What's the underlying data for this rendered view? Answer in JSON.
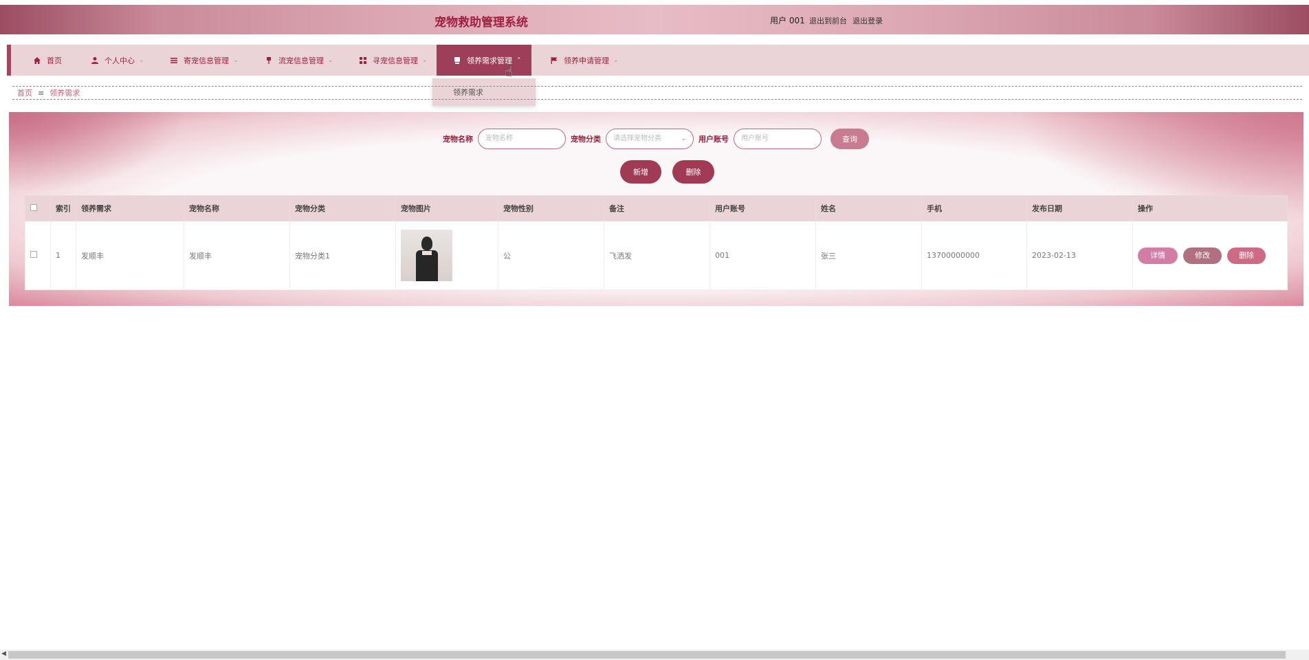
{
  "header": {
    "title": "宠物救助管理系统",
    "user": "用户 001",
    "to_front": "退出到前台",
    "logout": "退出登录"
  },
  "nav": [
    {
      "label": "首页",
      "icon": "home-icon"
    },
    {
      "label": "个人中心",
      "icon": "user-icon"
    },
    {
      "label": "寄宠信息管理",
      "icon": "list-icon"
    },
    {
      "label": "流宠信息管理",
      "icon": "pin-icon"
    },
    {
      "label": "寻宠信息管理",
      "icon": "grid-icon"
    },
    {
      "label": "领养需求管理",
      "icon": "doc-icon"
    },
    {
      "label": "领养申请管理",
      "icon": "flag-icon"
    }
  ],
  "dropdown": {
    "item": "领养需求"
  },
  "breadcrumb": {
    "home": "首页",
    "current": "领养需求"
  },
  "search": {
    "name_label": "宠物名称",
    "name_placeholder": "宠物名称",
    "category_label": "宠物分类",
    "category_placeholder": "请选择宠物分类",
    "account_label": "用户账号",
    "account_placeholder": "用户账号",
    "query_button": "查询"
  },
  "actions": {
    "add": "新增",
    "delete": "删除"
  },
  "table": {
    "headers": [
      "索引",
      "领养需求",
      "宠物名称",
      "宠物分类",
      "宠物图片",
      "宠物性别",
      "备注",
      "用户账号",
      "姓名",
      "手机",
      "发布日期",
      "操作"
    ],
    "rows": [
      {
        "index": "1",
        "demand": "发顺丰",
        "pet_name": "发顺丰",
        "category": "宠物分类1",
        "gender": "公",
        "note": "飞洒发",
        "account": "001",
        "name": "张三",
        "phone": "13700000000",
        "date": "2023-02-13",
        "btn_detail": "详情",
        "btn_edit": "修改",
        "btn_delete": "删除"
      }
    ]
  },
  "colors": {
    "accent": "#a13a55",
    "nav_bg": "#ead4d8",
    "title": "#a0203f"
  }
}
